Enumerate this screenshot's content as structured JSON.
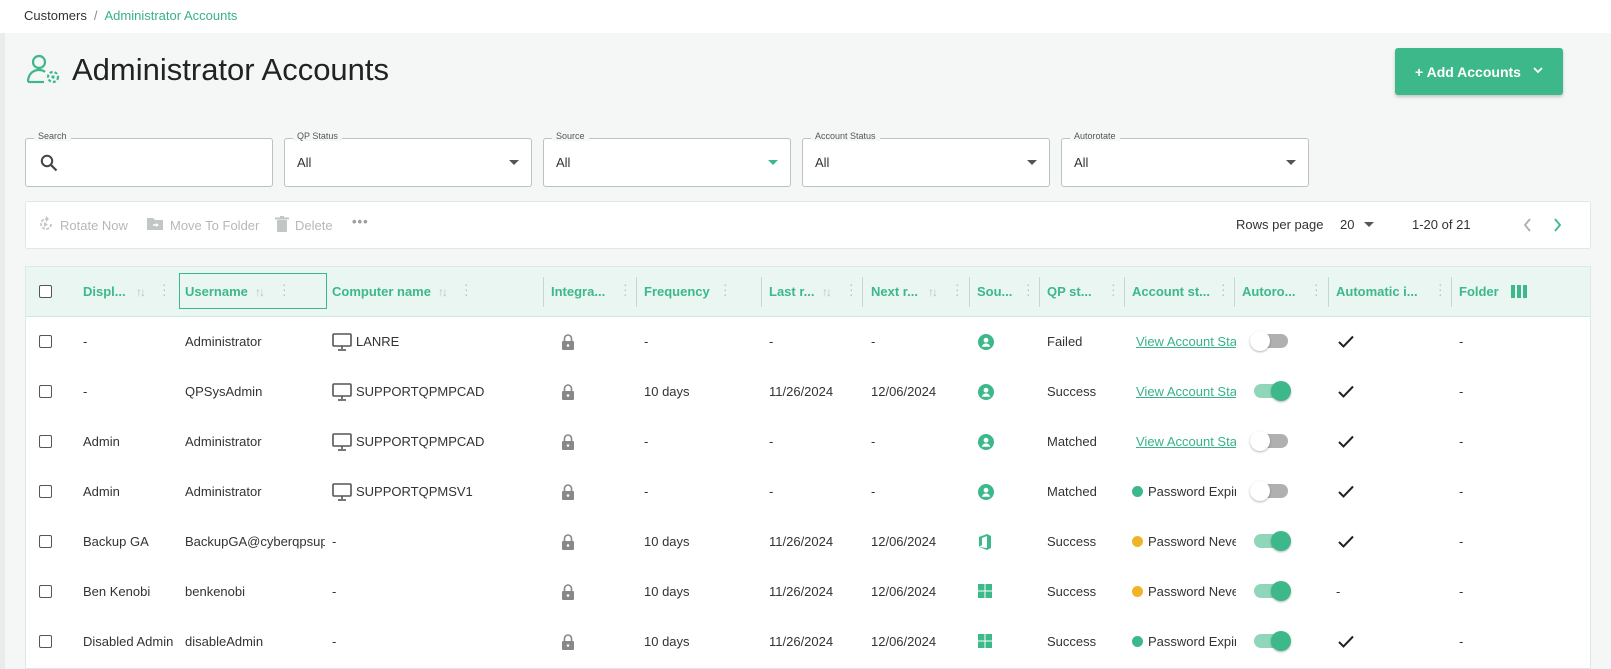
{
  "breadcrumb": {
    "root": "Customers",
    "separator": "/",
    "current": "Administrator Accounts"
  },
  "page": {
    "title": "Administrator Accounts",
    "icon": "user-gear-icon"
  },
  "add_button": {
    "label": "+ Add Accounts",
    "icon": "chevron-down-icon"
  },
  "filters": {
    "search": {
      "label": "Search",
      "value": "",
      "icon": "search-icon"
    },
    "qp_status": {
      "label": "QP Status",
      "value": "All"
    },
    "source": {
      "label": "Source",
      "value": "All"
    },
    "account_status": {
      "label": "Account Status",
      "value": "All"
    },
    "autorotate": {
      "label": "Autorotate",
      "value": "All"
    }
  },
  "toolbar": {
    "rotate_now": "Rotate Now",
    "move_to_folder": "Move To Folder",
    "delete": "Delete",
    "more": "more-icon"
  },
  "pagination": {
    "rows_per_page_label": "Rows per page",
    "rows_per_page": "20",
    "range": "1-20 of 21"
  },
  "columns": {
    "display": "Displ...",
    "username": "Username",
    "computer": "Computer name",
    "integration": "Integra...",
    "frequency": "Frequency",
    "last": "Last r...",
    "next": "Next r...",
    "source": "Sou...",
    "qp_status": "QP st...",
    "account_status": "Account st...",
    "autorotate": "Autoro...",
    "automatic": "Automatic i...",
    "folder": "Folder"
  },
  "colors": {
    "accent": "#3db88a",
    "warning": "#f0b429",
    "header_bg": "#e9f6f1"
  },
  "rows": [
    {
      "display": "-",
      "username": "Administrator",
      "computer": "LANRE",
      "computer_icon": true,
      "frequency": "-",
      "last": "-",
      "next": "-",
      "source": "user-circle-icon",
      "qp_status": "Failed",
      "account_status": "View Account Sta",
      "status_kind": "link",
      "autorotate": false,
      "automatic": "check",
      "folder": "-"
    },
    {
      "display": "-",
      "username": "QPSysAdmin",
      "computer": "SUPPORTQPMPCAD",
      "computer_icon": true,
      "frequency": "10 days",
      "last": "11/26/2024",
      "next": "12/06/2024",
      "source": "user-circle-icon",
      "qp_status": "Success",
      "account_status": "View Account Sta",
      "status_kind": "link",
      "autorotate": true,
      "automatic": "check",
      "folder": "-"
    },
    {
      "display": "Admin",
      "username": "Administrator",
      "computer": "SUPPORTQPMPCAD",
      "computer_icon": true,
      "frequency": "-",
      "last": "-",
      "next": "-",
      "source": "user-circle-icon",
      "qp_status": "Matched",
      "account_status": "View Account Sta",
      "status_kind": "link",
      "autorotate": false,
      "automatic": "check",
      "folder": "-"
    },
    {
      "display": "Admin",
      "username": "Administrator",
      "computer": "SUPPORTQPMSV1",
      "computer_icon": true,
      "frequency": "-",
      "last": "-",
      "next": "-",
      "source": "user-circle-icon",
      "qp_status": "Matched",
      "account_status": "Password Expir",
      "status_kind": "green",
      "autorotate": false,
      "automatic": "check",
      "folder": "-"
    },
    {
      "display": "Backup GA",
      "username": "BackupGA@cyberqpsup",
      "computer": "-",
      "computer_icon": false,
      "frequency": "10 days",
      "last": "11/26/2024",
      "next": "12/06/2024",
      "source": "office-icon",
      "qp_status": "Success",
      "account_status": "Password Neve",
      "status_kind": "yellow",
      "autorotate": true,
      "automatic": "check",
      "folder": "-"
    },
    {
      "display": "Ben Kenobi",
      "username": "benkenobi",
      "computer": "-",
      "computer_icon": false,
      "frequency": "10 days",
      "last": "11/26/2024",
      "next": "12/06/2024",
      "source": "windows-icon",
      "qp_status": "Success",
      "account_status": "Password Neve",
      "status_kind": "yellow",
      "autorotate": true,
      "automatic": "-",
      "folder": "-"
    },
    {
      "display": "Disabled Admin",
      "username": "disableAdmin",
      "computer": "-",
      "computer_icon": false,
      "frequency": "10 days",
      "last": "11/26/2024",
      "next": "12/06/2024",
      "source": "windows-icon",
      "qp_status": "Success",
      "account_status": "Password Expir",
      "status_kind": "green",
      "autorotate": true,
      "automatic": "check",
      "folder": "-"
    }
  ]
}
